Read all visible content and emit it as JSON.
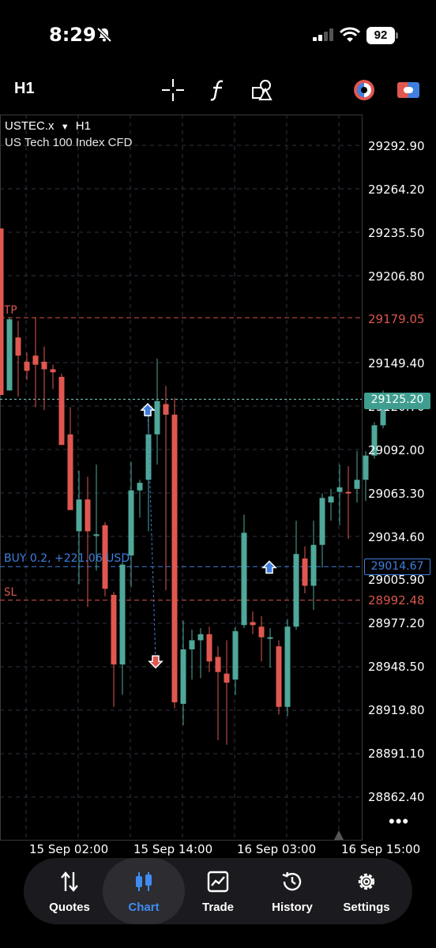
{
  "status_bar": {
    "time": "8:29",
    "battery": "92"
  },
  "toolbar": {
    "timeframe": "H1",
    "icons": [
      "crosshair-icon",
      "indicator-f-icon",
      "objects-icon",
      "color-scheme-icon",
      "one-click-trading-icon"
    ]
  },
  "chart": {
    "symbol": "USTEC.x",
    "timeframe": "H1",
    "description": "US Tech 100 Index CFD",
    "tp_label": "TP",
    "sl_label": "SL",
    "position_label": "BUY 0.2, +221.06 USD",
    "tp_price": "29179.05",
    "sl_price": "28992.48",
    "position_price": "29014.67",
    "current_price": "29125.20",
    "hidden_tick": "29120.70",
    "price_ticks": [
      "29292.90",
      "29264.20",
      "29235.50",
      "29206.80",
      "29149.40",
      "29092.00",
      "29063.30",
      "29034.60",
      "29005.90",
      "28977.20",
      "28948.50",
      "28919.80",
      "28891.10",
      "28862.40"
    ],
    "date_ticks": [
      "15 Sep 02:00",
      "15 Sep 14:00",
      "16 Sep 03:00",
      "16 Sep 15:00"
    ],
    "more": "•••",
    "colors": {
      "bull": "#4fa89a",
      "bear": "#e0574f",
      "tp_sl": "#d9564c",
      "position": "#3f7fe0",
      "current": "#7cd3c6"
    }
  },
  "chart_data": {
    "type": "candlestick",
    "title": "USTEC.x H1",
    "ylim": [
      28850,
      29310
    ],
    "candles": [
      {
        "o": 29238,
        "h": 29238,
        "l": 29128,
        "c": 29128
      },
      {
        "o": 29131,
        "h": 29179,
        "l": 29131,
        "c": 29178
      },
      {
        "o": 29166,
        "h": 29177,
        "l": 29127,
        "c": 29154
      },
      {
        "o": 29150,
        "h": 29156,
        "l": 29138,
        "c": 29144
      },
      {
        "o": 29154,
        "h": 29179,
        "l": 29120,
        "c": 29148
      },
      {
        "o": 29150,
        "h": 29160,
        "l": 29118,
        "c": 29145
      },
      {
        "o": 29145,
        "h": 29148,
        "l": 29132,
        "c": 29143
      },
      {
        "o": 29140,
        "h": 29142,
        "l": 29095,
        "c": 29095
      },
      {
        "o": 29102,
        "h": 29120,
        "l": 29055,
        "c": 29052
      },
      {
        "o": 29038,
        "h": 29078,
        "l": 29003,
        "c": 29059
      },
      {
        "o": 29059,
        "h": 29074,
        "l": 28988,
        "c": 29038
      },
      {
        "o": 29036,
        "h": 29082,
        "l": 29012,
        "c": 29036
      },
      {
        "o": 29042,
        "h": 29044,
        "l": 28995,
        "c": 29000
      },
      {
        "o": 28996,
        "h": 28998,
        "l": 28922,
        "c": 28950
      },
      {
        "o": 28950,
        "h": 29018,
        "l": 28930,
        "c": 29016
      },
      {
        "o": 29022,
        "h": 29084,
        "l": 29001,
        "c": 29065
      },
      {
        "o": 29065,
        "h": 29072,
        "l": 29047,
        "c": 29070
      },
      {
        "o": 29072,
        "h": 29116,
        "l": 29038,
        "c": 29102
      },
      {
        "o": 29102,
        "h": 29152,
        "l": 29082,
        "c": 29124
      },
      {
        "o": 29122,
        "h": 29134,
        "l": 28999,
        "c": 29115
      },
      {
        "o": 29115,
        "h": 29126,
        "l": 28921,
        "c": 28925
      },
      {
        "o": 28924,
        "h": 28979,
        "l": 28910,
        "c": 28960
      },
      {
        "o": 28960,
        "h": 28973,
        "l": 28940,
        "c": 28966
      },
      {
        "o": 28966,
        "h": 28974,
        "l": 28941,
        "c": 28970
      },
      {
        "o": 28970,
        "h": 28975,
        "l": 28945,
        "c": 28952
      },
      {
        "o": 28955,
        "h": 28962,
        "l": 28900,
        "c": 28945
      },
      {
        "o": 28944,
        "h": 28966,
        "l": 28897,
        "c": 28938
      },
      {
        "o": 28940,
        "h": 28975,
        "l": 28930,
        "c": 28972
      },
      {
        "o": 28976,
        "h": 29049,
        "l": 28974,
        "c": 29037
      },
      {
        "o": 28978,
        "h": 28985,
        "l": 28970,
        "c": 28976
      },
      {
        "o": 28975,
        "h": 28982,
        "l": 28952,
        "c": 28968
      },
      {
        "o": 28968,
        "h": 28974,
        "l": 28948,
        "c": 28968
      },
      {
        "o": 28962,
        "h": 28966,
        "l": 28917,
        "c": 28922
      },
      {
        "o": 28922,
        "h": 28980,
        "l": 28916,
        "c": 28975
      },
      {
        "o": 28975,
        "h": 29045,
        "l": 28973,
        "c": 29023
      },
      {
        "o": 29020,
        "h": 29028,
        "l": 28997,
        "c": 29002
      },
      {
        "o": 29002,
        "h": 29045,
        "l": 28986,
        "c": 29029
      },
      {
        "o": 29029,
        "h": 29063,
        "l": 29014,
        "c": 29060
      },
      {
        "o": 29057,
        "h": 29066,
        "l": 29045,
        "c": 29061
      },
      {
        "o": 29064,
        "h": 29082,
        "l": 29042,
        "c": 29067
      },
      {
        "o": 29064,
        "h": 29081,
        "l": 29033,
        "c": 29063
      },
      {
        "o": 29066,
        "h": 29091,
        "l": 29057,
        "c": 29072
      },
      {
        "o": 29072,
        "h": 29091,
        "l": 29058,
        "c": 29088
      },
      {
        "o": 29088,
        "h": 29110,
        "l": 29086,
        "c": 29108
      },
      {
        "o": 29108,
        "h": 29131,
        "l": 29106,
        "c": 29125
      }
    ],
    "horizontal_lines": [
      {
        "name": "TP",
        "value": 29179.05
      },
      {
        "name": "SL",
        "value": 28992.48
      },
      {
        "name": "BUY 0.2",
        "value": 29014.67
      },
      {
        "name": "current",
        "value": 29125.2
      }
    ]
  },
  "bottom_nav": {
    "items": [
      {
        "label": "Quotes",
        "icon": "quotes-arrows-icon"
      },
      {
        "label": "Chart",
        "icon": "chart-candles-icon"
      },
      {
        "label": "Trade",
        "icon": "trade-chart-icon"
      },
      {
        "label": "History",
        "icon": "history-clock-icon"
      },
      {
        "label": "Settings",
        "icon": "settings-gear-icon"
      }
    ],
    "active_color": "#3f8cf0"
  }
}
